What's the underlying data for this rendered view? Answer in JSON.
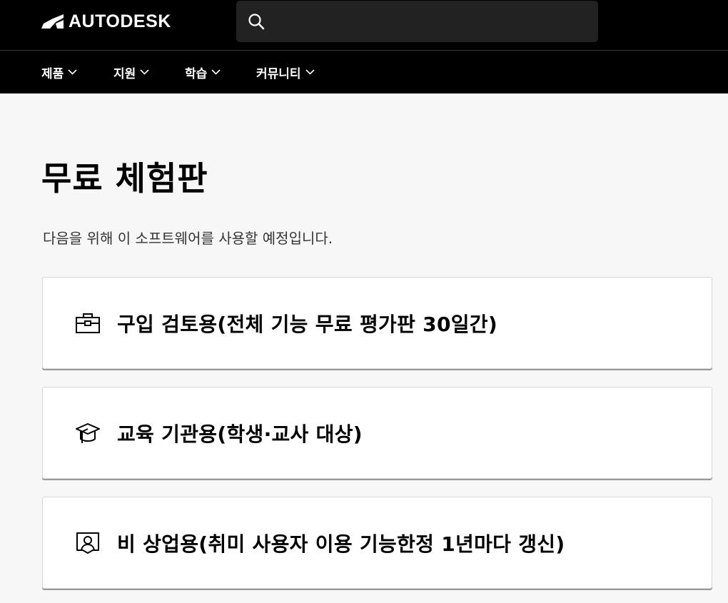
{
  "header": {
    "brand": "AUTODESK",
    "search": {
      "value": "",
      "placeholder": ""
    }
  },
  "nav": {
    "items": [
      {
        "label": "제품"
      },
      {
        "label": "지원"
      },
      {
        "label": "학습"
      },
      {
        "label": "커뮤니티"
      }
    ]
  },
  "main": {
    "title": "무료 체험판",
    "subtitle": "다음을 위해 이 소프트웨어를 사용할 예정입니다.",
    "options": [
      {
        "label": "구입 검토용(전체 기능 무료 평가판 30일간)",
        "icon": "briefcase-icon"
      },
      {
        "label": "교육 기관용(학생·교사 대상)",
        "icon": "graduation-cap-icon"
      },
      {
        "label": "비 상업용(취미 사용자 이용 기능한정 1년마다 갱신)",
        "icon": "user-portrait-icon"
      }
    ]
  },
  "colors": {
    "header_bg": "#000000",
    "search_bg": "#222222",
    "page_bg": "#f7f7f7",
    "card_bg": "#ffffff",
    "text": "#000000"
  }
}
